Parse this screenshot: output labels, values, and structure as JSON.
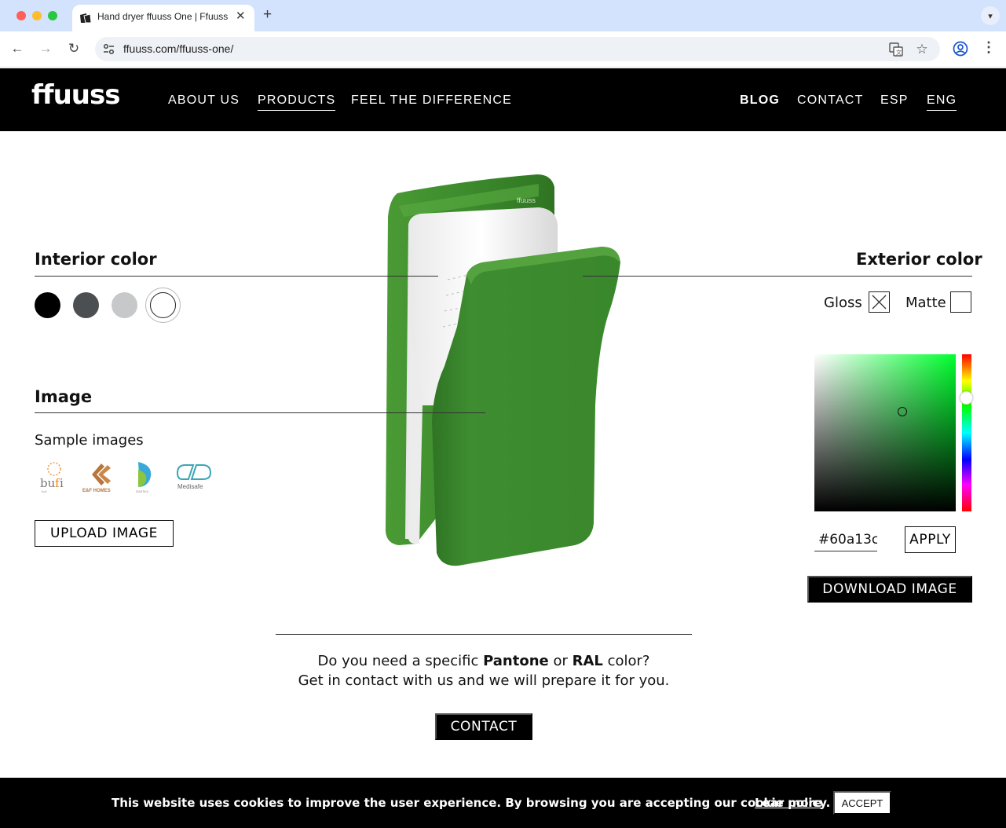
{
  "browser": {
    "tab_title": "Hand dryer ffuuss One | Ffuuss",
    "url": "ffuuss.com/ffuuss-one/"
  },
  "header": {
    "logo": "ffuuss",
    "menu_left": [
      "ABOUT US",
      "PRODUCTS",
      "FEEL THE DIFFERENCE"
    ],
    "menu_right": [
      "BLOG",
      "CONTACT",
      "ESP",
      "ENG"
    ]
  },
  "configurator": {
    "interior_title": "Interior color",
    "interior_swatches": [
      "#000000",
      "#4b4f52",
      "#c7c8c9",
      "#ffffff"
    ],
    "image_title": "Image",
    "sample_images_label": "Sample images",
    "sample_logos": [
      "bufi",
      "E&F HOMES",
      "DIASTIKA",
      "Medisafe"
    ],
    "upload_label": "UPLOAD IMAGE",
    "exterior_title": "Exterior color",
    "gloss_label": "Gloss",
    "matte_label": "Matte",
    "hex_value": "#60a13c",
    "apply_label": "APPLY",
    "download_label": "DOWNLOAD IMAGE",
    "product_color": "#3e8d2f"
  },
  "pantone": {
    "line1_a": "Do you need a specific ",
    "pantone": "Pantone",
    "line1_b": " or ",
    "ral": "RAL",
    "line1_c": " color?",
    "line2": "Get in contact with us and we will prepare it for you.",
    "contact_label": "CONTACT"
  },
  "cookie": {
    "text": "This website uses cookies to improve the user experience. By browsing you are accepting our cookie policy.",
    "link": "Lear more",
    "accept": "ACCEPT"
  }
}
